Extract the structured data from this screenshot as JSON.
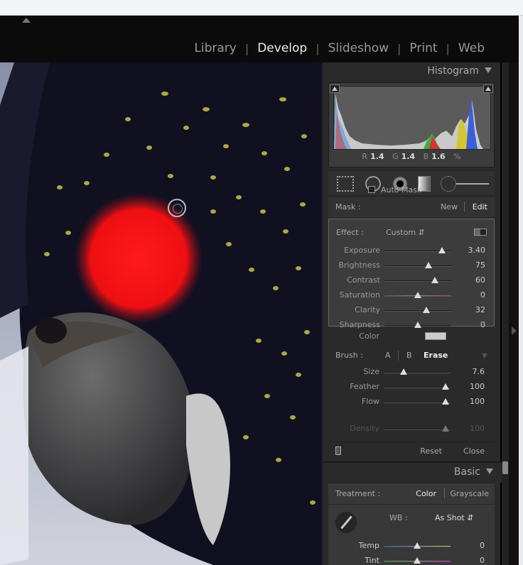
{
  "modules": [
    {
      "label": "Library",
      "active": false
    },
    {
      "label": "Develop",
      "active": true
    },
    {
      "label": "Slideshow",
      "active": false
    },
    {
      "label": "Print",
      "active": false
    },
    {
      "label": "Web",
      "active": false
    }
  ],
  "histogram": {
    "title": "Histogram",
    "r_label": "R",
    "r_value": "1.4",
    "g_label": "G",
    "g_value": "1.4",
    "b_label": "B",
    "b_value": "1.6",
    "unit": "%"
  },
  "mask": {
    "label": "Mask :",
    "new_label": "New",
    "edit_label": "Edit"
  },
  "effect": {
    "label": "Effect :",
    "preset": "Custom",
    "sliders": [
      {
        "name": "Exposure",
        "value": "3.40",
        "pos": 0.86
      },
      {
        "name": "Brightness",
        "value": "75",
        "pos": 0.66
      },
      {
        "name": "Contrast",
        "value": "60",
        "pos": 0.76
      },
      {
        "name": "Saturation",
        "value": "0",
        "pos": 0.5
      },
      {
        "name": "Clarity",
        "value": "32",
        "pos": 0.63
      },
      {
        "name": "Sharpness",
        "value": "0",
        "pos": 0.5
      }
    ],
    "color_label": "Color",
    "color_swatch": "#cccccc"
  },
  "brush": {
    "label": "Brush :",
    "option_a": "A",
    "option_b": "B",
    "option_erase": "Erase",
    "sliders": [
      {
        "name": "Size",
        "value": "7.6",
        "pos": 0.3
      },
      {
        "name": "Feather",
        "value": "100",
        "pos": 0.93
      },
      {
        "name": "Flow",
        "value": "100",
        "pos": 0.93
      }
    ],
    "auto_mask": "Auto Mask",
    "density_label": "Density",
    "density_value": "100",
    "density_pos": 0.93
  },
  "actions": {
    "reset": "Reset",
    "close": "Close"
  },
  "basic": {
    "title": "Basic",
    "treatment_label": "Treatment :",
    "treatment_color": "Color",
    "treatment_grayscale": "Grayscale",
    "wb_label": "WB :",
    "wb_value": "As Shot",
    "temp_label": "Temp",
    "temp_value": "0",
    "temp_pos": 0.5,
    "tint_label": "Tint",
    "tint_value": "0",
    "tint_pos": 0.5
  }
}
